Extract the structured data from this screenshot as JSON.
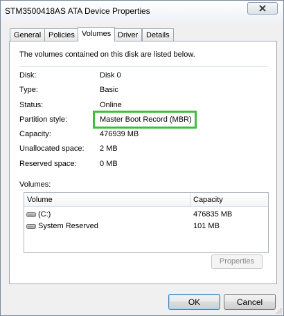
{
  "window": {
    "title": "STM3500418AS ATA Device Properties"
  },
  "tabs": [
    {
      "label": "General"
    },
    {
      "label": "Policies"
    },
    {
      "label": "Volumes"
    },
    {
      "label": "Driver"
    },
    {
      "label": "Details"
    }
  ],
  "active_tab": "Volumes",
  "panel": {
    "intro": "The volumes contained on this disk are listed below.",
    "fields": [
      {
        "label": "Disk:",
        "value": "Disk 0"
      },
      {
        "label": "Type:",
        "value": "Basic"
      },
      {
        "label": "Status:",
        "value": "Online"
      },
      {
        "label": "Partition style:",
        "value": "Master Boot Record (MBR)"
      },
      {
        "label": "Capacity:",
        "value": "476939 MB"
      },
      {
        "label": "Unallocated space:",
        "value": "2 MB"
      },
      {
        "label": "Reserved space:",
        "value": "0 MB"
      }
    ],
    "highlight_color": "#3cc03c",
    "volumes_label": "Volumes:",
    "columns": {
      "volume": "Volume",
      "capacity": "Capacity"
    },
    "volumes": [
      {
        "name": "(C:)",
        "capacity": "476835 MB",
        "icon": "drive-icon"
      },
      {
        "name": "System Reserved",
        "capacity": "101 MB",
        "icon": "drive-icon"
      }
    ],
    "properties_button": "Properties"
  },
  "buttons": {
    "ok": "OK",
    "cancel": "Cancel"
  }
}
